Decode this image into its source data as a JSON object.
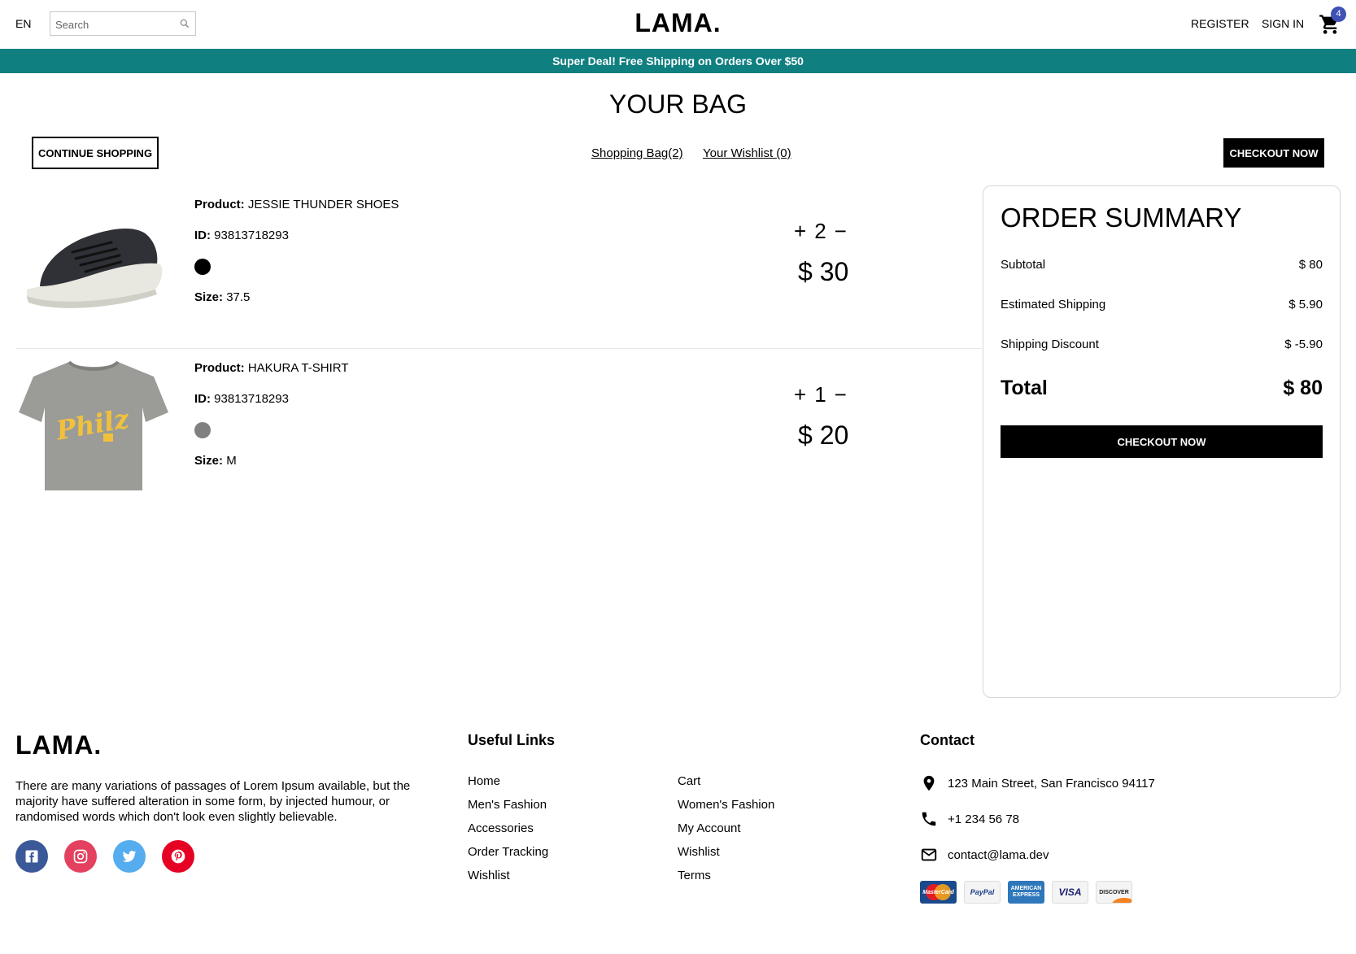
{
  "navbar": {
    "language": "EN",
    "search_placeholder": "Search",
    "logo": "LAMA.",
    "register": "REGISTER",
    "sign_in": "SIGN IN",
    "cart_count": "4",
    "badge_color": "#3f51b5"
  },
  "announcement": {
    "text": "Super Deal! Free Shipping on Orders Over $50",
    "color": "#0f7f80"
  },
  "cart": {
    "title": "YOUR BAG",
    "continue_label": "CONTINUE SHOPPING",
    "shopping_bag_link": "Shopping Bag(2)",
    "wishlist_link": "Your Wishlist (0)",
    "checkout_label": "CHECKOUT NOW",
    "product_label": "Product:",
    "id_label": "ID:",
    "size_label": "Size:",
    "plus": "+",
    "minus": "−",
    "products": [
      {
        "name": "JESSIE THUNDER SHOES",
        "id": "93813718293",
        "color": "#000000",
        "size": "37.5",
        "quantity": "2",
        "price": "$ 30",
        "image_icon": "shoe-image"
      },
      {
        "name": "HAKURA T-SHIRT",
        "id": "93813718293",
        "color": "#808080",
        "size": "M",
        "quantity": "1",
        "price": "$ 20",
        "image_icon": "tshirt-image"
      }
    ]
  },
  "summary": {
    "title": "ORDER SUMMARY",
    "subtotal_label": "Subtotal",
    "subtotal_value": "$ 80",
    "shipping_label": "Estimated Shipping",
    "shipping_value": "$ 5.90",
    "discount_label": "Shipping Discount",
    "discount_value": "$ -5.90",
    "total_label": "Total",
    "total_value": "$ 80",
    "checkout_label": "CHECKOUT NOW"
  },
  "footer": {
    "logo": "LAMA.",
    "description": "There are many variations of passages of Lorem Ipsum available, but the majority have suffered alteration in some form, by injected humour, or randomised words which don't look even slightly believable.",
    "social": [
      "facebook-icon",
      "instagram-icon",
      "twitter-icon",
      "pinterest-icon"
    ],
    "useful_links_title": "Useful Links",
    "links_col1": [
      "Home",
      "Men's Fashion",
      "Accessories",
      "Order Tracking",
      "Wishlist"
    ],
    "links_col2": [
      "Cart",
      "Women's Fashion",
      "My Account",
      "Wishlist",
      "Terms"
    ],
    "contact_title": "Contact",
    "address": "123 Main Street, San Francisco 94117",
    "phone": "+1 234 56 78",
    "email": "contact@lama.dev",
    "payments": [
      "MasterCard",
      "PayPal",
      "AMERICAN EXPRESS",
      "VISA",
      "DISCOVER"
    ]
  }
}
